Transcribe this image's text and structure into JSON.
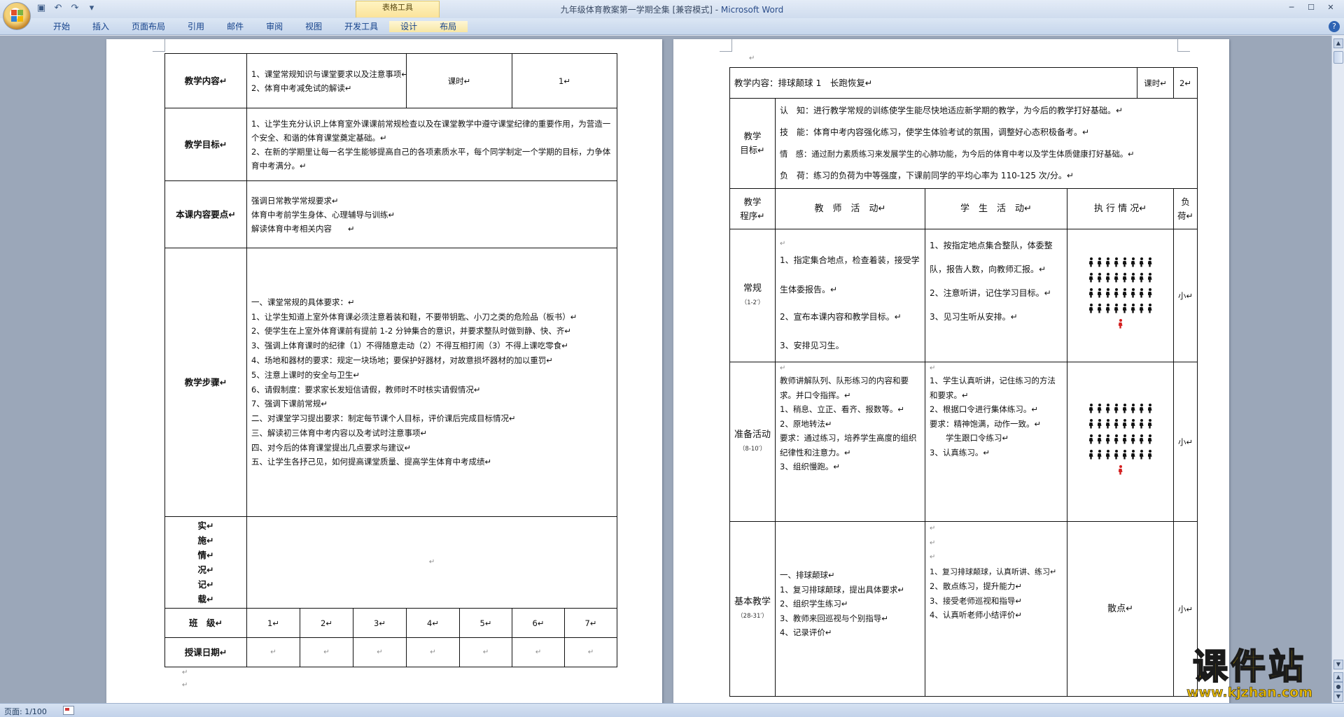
{
  "app": {
    "window_title": "九年级体育教案第一学期全集 [兼容模式] - ",
    "app_name": "Microsoft Word",
    "context_tab_group": "表格工具",
    "tabs": [
      "开始",
      "插入",
      "页面布局",
      "引用",
      "邮件",
      "审阅",
      "视图",
      "开发工具",
      "设计",
      "布局"
    ],
    "quick_access": [
      "save-icon",
      "undo-icon",
      "redo-icon",
      "customize-icon"
    ],
    "window_controls": [
      "minimize-icon",
      "maximize-icon",
      "close-icon"
    ]
  },
  "status": {
    "page": "页面: 1/100"
  },
  "marks": {
    "para": "↵"
  },
  "left_page": {
    "content_label": "教学内容↵",
    "content_items": [
      "1、课堂常规知识与课堂要求以及注意事项↵",
      "2、体育中考减免试的解读↵"
    ],
    "hours_label": "课时↵",
    "hours_value": "1↵",
    "goal_label": "教学目标↵",
    "goal_items": [
      "1、让学生充分认识上体育室外课课前常规检查以及在课堂教学中遵守课堂纪律的重要作用，为营造一个安全、和谐的体育课堂奠定基础。↵",
      "2、在新的学期里让每一名学生能够提高自己的各项素质水平，每个同学制定一个学期的目标，力争体育中考满分。↵"
    ],
    "key_label": "本课内容要点↵",
    "key_items": [
      "强调日常教学常规要求↵",
      "体育中考前学生身体、心理辅导与训练↵",
      "解读体育中考相关内容　　↵"
    ],
    "steps_label": "教学步骤↵",
    "steps_items": [
      "一、课堂常规的具体要求：↵",
      "1、让学生知道上室外体育课必须注意着装和鞋，不要带钥匙、小刀之类的危险品（板书）↵",
      "2、使学生在上室外体育课前有提前 1-2 分钟集合的意识，并要求整队时做到静、快、齐↵",
      "3、强调上体育课时的纪律（1）不得随意走动（2）不得互相打闹（3）不得上课吃零食↵",
      "4、场地和器材的要求：规定一块场地；要保护好器材，对故意损坏器材的加以重罚↵",
      "5、注意上课时的安全与卫生↵",
      "6、请假制度：要求家长发短信请假，教师时不时核实请假情况↵",
      "7、强调下课前常规↵",
      "二、对课堂学习提出要求：制定每节课个人目标，评价课后完成目标情况↵",
      "三、解读初三体育中考内容以及考试时注意事项↵",
      "四、对今后的体育课堂提出几点要求与建议↵",
      "五、让学生各抒己见，如何提高课堂质量、提高学生体育中考成绩↵"
    ],
    "record_label_chars": [
      "实↵",
      "施↵",
      "情↵",
      "况↵",
      "记↵",
      "载↵"
    ],
    "record_value": "↵",
    "class_label": "班　级↵",
    "class_numbers": [
      "1↵",
      "2↵",
      "3↵",
      "4↵",
      "5↵",
      "6↵",
      "7↵"
    ],
    "date_label": "授课日期↵",
    "date_values": [
      "↵",
      "↵",
      "↵",
      "↵",
      "↵",
      "↵",
      "↵"
    ]
  },
  "right_page": {
    "content_line": "教学内容：排球颠球 1　长跑恢复↵",
    "hours_label": "课时↵",
    "hours_value": "2↵",
    "goal_label_lines": [
      "教学",
      "目标↵"
    ],
    "goal_items": [
      "认　知：进行教学常规的训练使学生能尽快地适应新学期的教学，为今后的教学打好基础。↵",
      "技　能：体育中考内容强化练习，使学生体验考试的氛围，调整好心态积极备考。↵",
      "情　感：通过耐力素质练习来发展学生的心肺功能，为今后的体育中考以及学生体质健康打好基础。↵",
      "负　荷：练习的负荷为中等强度，下课前同学的平均心率为 110-125 次/分。↵"
    ],
    "headers": {
      "procedure": [
        "教学",
        "程序↵"
      ],
      "teacher": "教　师　活　动↵",
      "student": "学　生　活　动↵",
      "execution": "执 行 情 况↵",
      "load": [
        "负",
        "荷↵"
      ]
    },
    "rows": [
      {
        "name": "常规",
        "time": "（1-2′）",
        "teacher": [
          "↵",
          "1、指定集合地点，检查着装，接受学生体委报告。↵",
          "2、宣布本课内容和教学目标。↵",
          "3、安排见习生。"
        ],
        "student": [
          "1、按指定地点集合整队，体委整队，报告人数，向教师汇报。↵",
          "2、注意听讲，记住学习目标。↵",
          "3、见习生听从安排。↵"
        ],
        "execution": "formation",
        "load": "小↵"
      },
      {
        "name": "准备活动",
        "time": "（8-10′）",
        "teacher": [
          "↵",
          "教师讲解队列、队形练习的内容和要求。并口令指挥。↵",
          "1、稍息、立正、看齐、报数等。↵",
          "2、原地转法↵",
          "要求：通过练习，培养学生高度的组织纪律性和注意力。↵",
          "3、组织慢跑。↵"
        ],
        "student": [
          "↵",
          "1、学生认真听讲，记住练习的方法和要求。↵",
          "2、根据口令进行集体练习。↵",
          "要求：精神饱满，动作一致。↵",
          "　　学生跟口令练习↵",
          "3、认真练习。↵"
        ],
        "execution": "formation",
        "load": "小↵"
      },
      {
        "name": "基本教学",
        "time": "（28-31′）",
        "teacher": [
          "一、排球颠球↵",
          "1、复习排球颠球，提出具体要求↵",
          "2、组织学生练习↵",
          "3、教师来回巡视与个别指导↵",
          "4、记录评价↵"
        ],
        "student": [
          "↵",
          "↵",
          "↵",
          "1、复习排球颠球，认真听讲、练习↵",
          "2、散点练习，提升能力↵",
          "3、接受老师巡视和指导↵",
          "4、认真听老师小结评价↵"
        ],
        "execution": "散点↵",
        "load": "小↵"
      }
    ]
  },
  "watermark": {
    "title": "课件站",
    "url": "www.kjzhan.com"
  },
  "colors": {
    "formation_teacher": "#d42020",
    "watermark": "#f5c400"
  }
}
